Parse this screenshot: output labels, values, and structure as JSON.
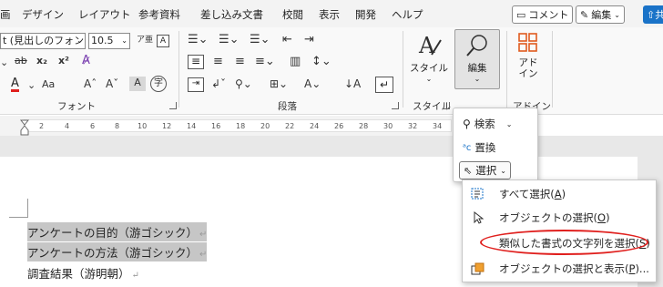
{
  "tabs": [
    "画",
    "デザイン",
    "レイアウト",
    "参考資料",
    "差し込み文書",
    "校閲",
    "表示",
    "開発",
    "ヘルプ"
  ],
  "header": {
    "comment_label": "コメント",
    "edit_label": "編集",
    "share_label": "共"
  },
  "font": {
    "name": "t (見出しのフォン",
    "size": "10.5",
    "group_label": "フォント",
    "clear_format_icon": "A",
    "bold_glyph": "x₂",
    "super_glyph": "x²",
    "strike_glyph": "ab",
    "aa_glyph": "Aa",
    "grow_glyph": "A^",
    "shrink_glyph": "Aˇ",
    "highlight_glyph": "A",
    "enclose_glyph": "字",
    "furigana_glyph": "ア亜",
    "color_glyph": "A"
  },
  "paragraph": {
    "group_label": "段落"
  },
  "style": {
    "label": "スタイル",
    "group_label": "スタイル"
  },
  "editing": {
    "label": "編集"
  },
  "addin": {
    "label": "アド イン",
    "group_label": "アドイン"
  },
  "ruler_ticks": [
    "2",
    "4",
    "6",
    "8",
    "10",
    "12",
    "14",
    "16",
    "18",
    "20",
    "22",
    "24",
    "26",
    "28",
    "30",
    "32",
    "34"
  ],
  "editing_menu": {
    "find": "検索",
    "replace": "置換",
    "select": "選択"
  },
  "select_menu": {
    "select_all": "すべて選択(",
    "select_all_key": "A",
    "select_objects": "オブジェクトの選択(",
    "select_objects_key": "O",
    "select_similar": "類似した書式の文字列を選択(",
    "select_similar_key": "S",
    "selection_pane": "オブジェクトの選択と表示(",
    "selection_pane_key": "P",
    "selection_pane_tail": ")...",
    "close_paren": ")"
  },
  "document": {
    "line1": "アンケートの目的（游ゴシック）",
    "line2": "アンケートの方法（游ゴシック）",
    "line3": "調査結果（游明朝）",
    "para_mark": "↵"
  },
  "colors": {
    "accent_red": "#e0201e",
    "share_blue": "#1a73c8",
    "selection_gray": "#c6c6c6"
  }
}
